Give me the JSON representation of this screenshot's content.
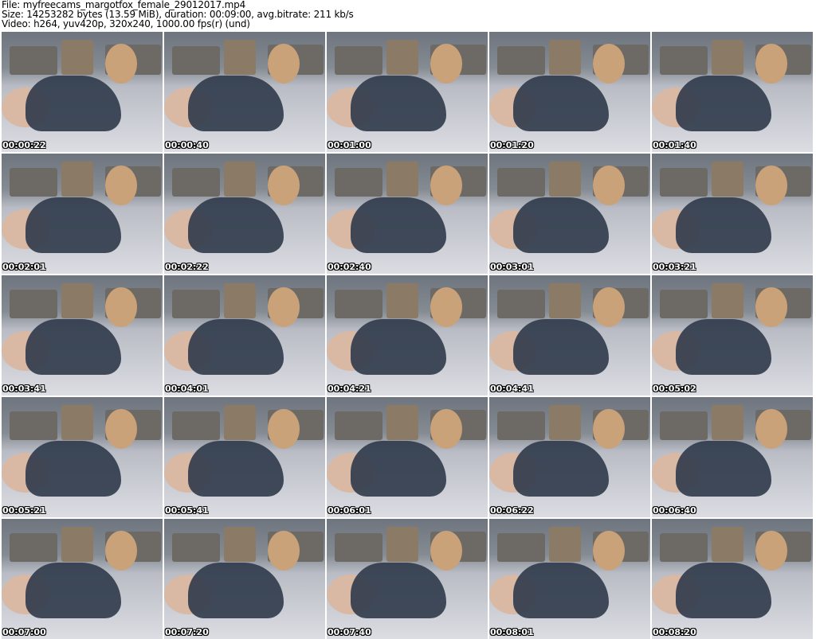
{
  "header": {
    "line1": "File: myfreecams_margotfox_female_29012017.mp4",
    "line2": "Size: 14253282 bytes (13.59 MiB), duration: 00:09:00, avg.bitrate: 211 kb/s",
    "line3": "Video: h264, yuv420p, 320x240, 1000.00 fps(r) (und)"
  },
  "timestamps": [
    "00:00:22",
    "00:00:40",
    "00:01:00",
    "00:01:20",
    "00:01:40",
    "00:02:01",
    "00:02:22",
    "00:02:40",
    "00:03:01",
    "00:03:21",
    "00:03:41",
    "00:04:01",
    "00:04:21",
    "00:04:41",
    "00:05:02",
    "00:05:21",
    "00:05:41",
    "00:06:01",
    "00:06:22",
    "00:06:40",
    "00:07:00",
    "00:07:20",
    "00:07:40",
    "00:08:01",
    "00:08:20"
  ]
}
